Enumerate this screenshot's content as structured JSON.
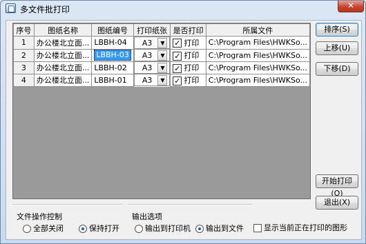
{
  "window": {
    "title": "多文件批打印",
    "close_label": "✕"
  },
  "table": {
    "columns": [
      "序号",
      "图纸名称",
      "图纸编号",
      "打印纸张",
      "是否打印",
      "所属文件"
    ],
    "rows": [
      {
        "index": "1",
        "name": "办公楼北立面...",
        "code": "LBBH-04",
        "paper": "A3",
        "print_label": "打印",
        "print_checked": true,
        "file": "C:\\Program Files\\HWKSo..."
      },
      {
        "index": "2",
        "name": "办公楼北立面...",
        "code": "LBBH-03",
        "paper": "A3",
        "print_label": "打印",
        "print_checked": true,
        "file": "C:\\Program Files\\HWKSo..."
      },
      {
        "index": "3",
        "name": "办公楼北立面...",
        "code": "LBBH-02",
        "paper": "A3",
        "print_label": "打印",
        "print_checked": true,
        "file": "C:\\Program Files\\HWKSo..."
      },
      {
        "index": "4",
        "name": "办公楼北立面...",
        "code": "LBBH-01",
        "paper": "A3",
        "print_label": "打印",
        "print_checked": true,
        "file": "C:\\Program Files\\HWKSo..."
      }
    ],
    "selected_row": 2
  },
  "buttons": {
    "sort": "排序(S)",
    "move_up": "上移(U)",
    "move_down": "下移(D)",
    "start_print": "开始打印(O)",
    "exit": "退出(X)"
  },
  "file_control": {
    "label": "文件操作控制",
    "close_all": "全部关闭",
    "keep_open": "保持打开",
    "selected": "keep_open"
  },
  "output": {
    "label": "输出选项",
    "to_printer": "输出到打印机",
    "to_file": "输出到文件",
    "selected": "to_file"
  },
  "show_current": {
    "label": "显示当前正在打印的图形",
    "checked": false
  },
  "icons": {
    "app": "print-app-icon",
    "dropdown": "chevron-down-icon",
    "check": "checkmark-icon"
  }
}
